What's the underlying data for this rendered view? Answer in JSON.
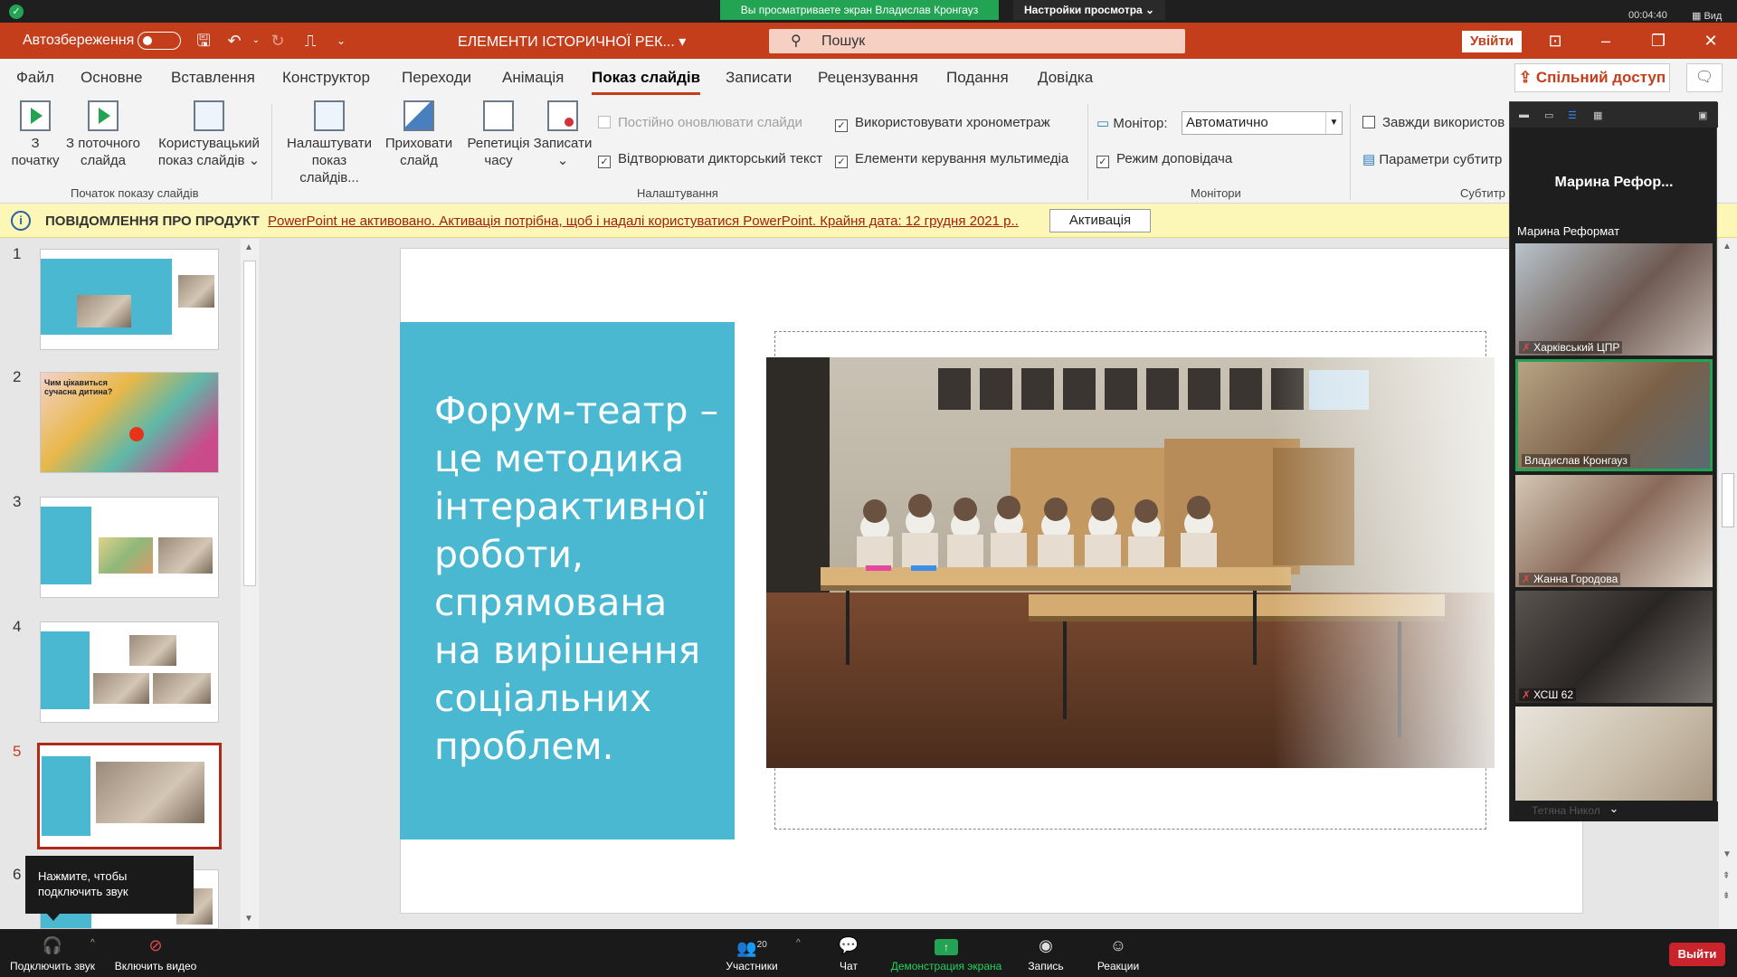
{
  "zoom": {
    "banner": "Вы просматриваете экран Владислав Кронгауз",
    "view_settings": "Настройки просмотра ⌄",
    "timer": "00:04:40",
    "view_label": "Вид"
  },
  "titlebar": {
    "autosave": "Автозбереження",
    "doc_title": "ЕЛЕМЕНТИ ІСТОРИЧНОЇ РЕК...",
    "search_placeholder": "Пошук",
    "signin": "Увійти"
  },
  "ribbon_tabs": [
    "Файл",
    "Основне",
    "Вставлення",
    "Конструктор",
    "Переходи",
    "Анімація",
    "Показ слайдів",
    "Записати",
    "Рецензування",
    "Подання",
    "Довідка"
  ],
  "active_tab": "Показ слайдів",
  "share": "Спільний доступ",
  "ribbon": {
    "buttons": [
      {
        "line1": "З",
        "line2": "початку"
      },
      {
        "line1": "З поточного",
        "line2": "слайда"
      },
      {
        "line1": "Користувацький",
        "line2": "показ слайдів ⌄"
      },
      {
        "line1": "Налаштувати",
        "line2": "показ слайдів..."
      },
      {
        "line1": "Приховати",
        "line2": "слайд"
      },
      {
        "line1": "Репетиція",
        "line2": "часу"
      },
      {
        "line1": "Записати",
        "line2": "⌄"
      }
    ],
    "checkboxes": {
      "keep_updated": "Постійно оновлювати слайди",
      "use_timings": "Використовувати хронометраж",
      "play_narration": "Відтворювати дикторський текст",
      "media_controls": "Елементи керування мультимедіа",
      "presenter_view": "Режим доповідача",
      "always_use": "Завжди використов"
    },
    "monitor_label": "Монітор:",
    "monitor_value": "Автоматично",
    "subtitle_settings": "Параметри субтитр",
    "groups": {
      "start": "Початок показу слайдів",
      "setup": "Налаштування",
      "monitors": "Монітори",
      "captions": "Субтитр"
    }
  },
  "notice": {
    "title": "ПОВІДОМЛЕННЯ ПРО ПРОДУКТ",
    "message": "PowerPoint не активовано. Активація потрібна, щоб і надалі користуватися PowerPoint. Крайня дата: 12 грудня 2021 р..",
    "button": "Активація"
  },
  "thumbnails": {
    "numbers": [
      "1",
      "2",
      "3",
      "4",
      "5",
      "6"
    ],
    "active": "5",
    "slide2_title": "Чим цікавиться сучасна дитина?"
  },
  "slide": {
    "text": "Форум-театр – це методика інтерактивної роботи, спрямована на вирішення соціальних проблем."
  },
  "participants": {
    "speaker_name": "Марина  Рефор...",
    "speaker_label": "Марина Реформат",
    "tiles": [
      {
        "name": "Харківський ЦПР",
        "muted": true
      },
      {
        "name": "Владислав Кронгауз",
        "muted": false
      },
      {
        "name": "Жанна Городова",
        "muted": true
      },
      {
        "name": "ХСШ 62",
        "muted": true
      },
      {
        "name": "",
        "muted": false
      }
    ],
    "more_ghost": "Тетяна Никол"
  },
  "tooltip": "Нажмите, чтобы подключить звук",
  "bottom": {
    "audio": "Подключить звук",
    "video": "Включить видео",
    "participants": "Участники",
    "participants_count": "20",
    "chat": "Чат",
    "share": "Демонстрация экрана",
    "record": "Запись",
    "reactions": "Реакции",
    "leave": "Выйти"
  }
}
